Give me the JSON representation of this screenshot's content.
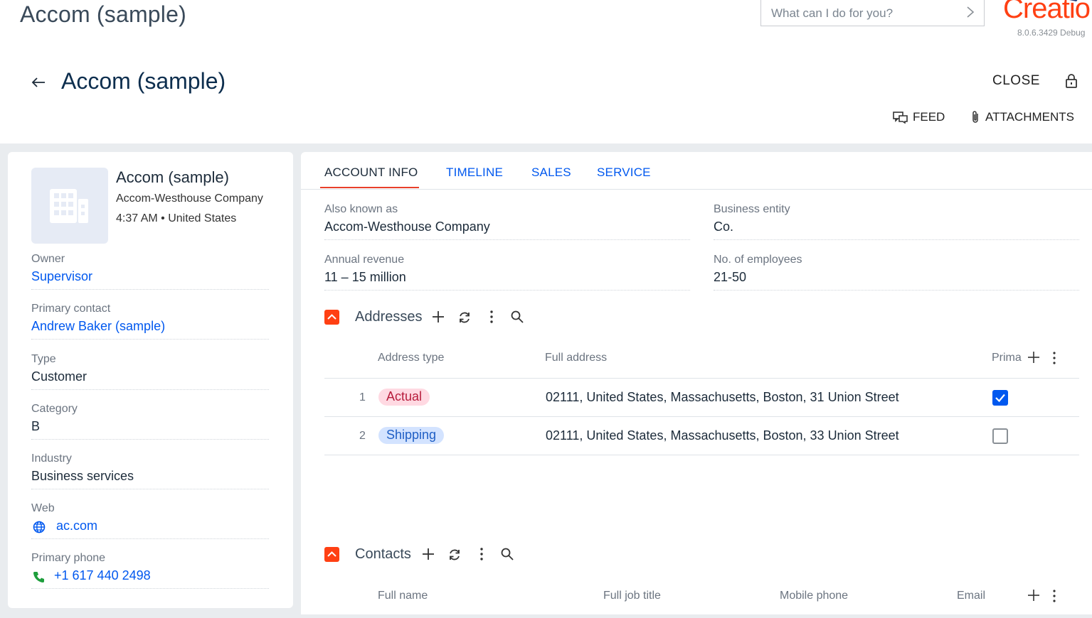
{
  "app": {
    "title": "Accom (sample)",
    "command_placeholder": "What can I do for you?",
    "logo_text": "Creatio",
    "version": "8.0.6.3429 Debug"
  },
  "header": {
    "page_title": "Accom (sample)",
    "close_label": "CLOSE",
    "feed_label": "FEED",
    "attachments_label": "ATTACHMENTS"
  },
  "profile": {
    "name": "Accom (sample)",
    "alias": "Accom-Westhouse Company",
    "local_time": "4:37 AM • United States",
    "fields": [
      {
        "label": "Owner",
        "value": "Supervisor"
      },
      {
        "label": "Primary contact",
        "value": "Andrew Baker (sample)"
      },
      {
        "label": "Type",
        "value": "Customer"
      },
      {
        "label": "Category",
        "value": "B"
      },
      {
        "label": "Industry",
        "value": "Business services"
      },
      {
        "label": "Web",
        "value": "ac.com"
      },
      {
        "label": "Primary phone",
        "value": "+1 617 440 2498"
      }
    ]
  },
  "tabs": [
    {
      "label": "ACCOUNT INFO",
      "active": true
    },
    {
      "label": "TIMELINE",
      "active": false
    },
    {
      "label": "SALES",
      "active": false
    },
    {
      "label": "SERVICE",
      "active": false
    }
  ],
  "account_info": {
    "fields": [
      {
        "label": "Also known as",
        "value": "Accom-Westhouse Company"
      },
      {
        "label": "Business entity",
        "value": "Co."
      },
      {
        "label": "Annual revenue",
        "value": "11 – 15 million"
      },
      {
        "label": "No. of employees",
        "value": "21-50"
      }
    ]
  },
  "addresses": {
    "title": "Addresses",
    "columns": [
      "Address type",
      "Full address",
      "Prima"
    ],
    "rows": [
      {
        "num": "1",
        "type": "Actual",
        "address": "02111, United States, Massachusetts, Boston, 31 Union Street",
        "primary": true
      },
      {
        "num": "2",
        "type": "Shipping",
        "address": "02111, United States, Massachusetts, Boston, 33 Union Street",
        "primary": false
      }
    ]
  },
  "contacts": {
    "title": "Contacts",
    "columns": [
      "Full name",
      "Full job title",
      "Mobile phone",
      "Email"
    ]
  },
  "colors": {
    "accent": "#ff4013",
    "link": "#0058ef",
    "title": "#0d2e4e",
    "band": "#e9ecef"
  }
}
